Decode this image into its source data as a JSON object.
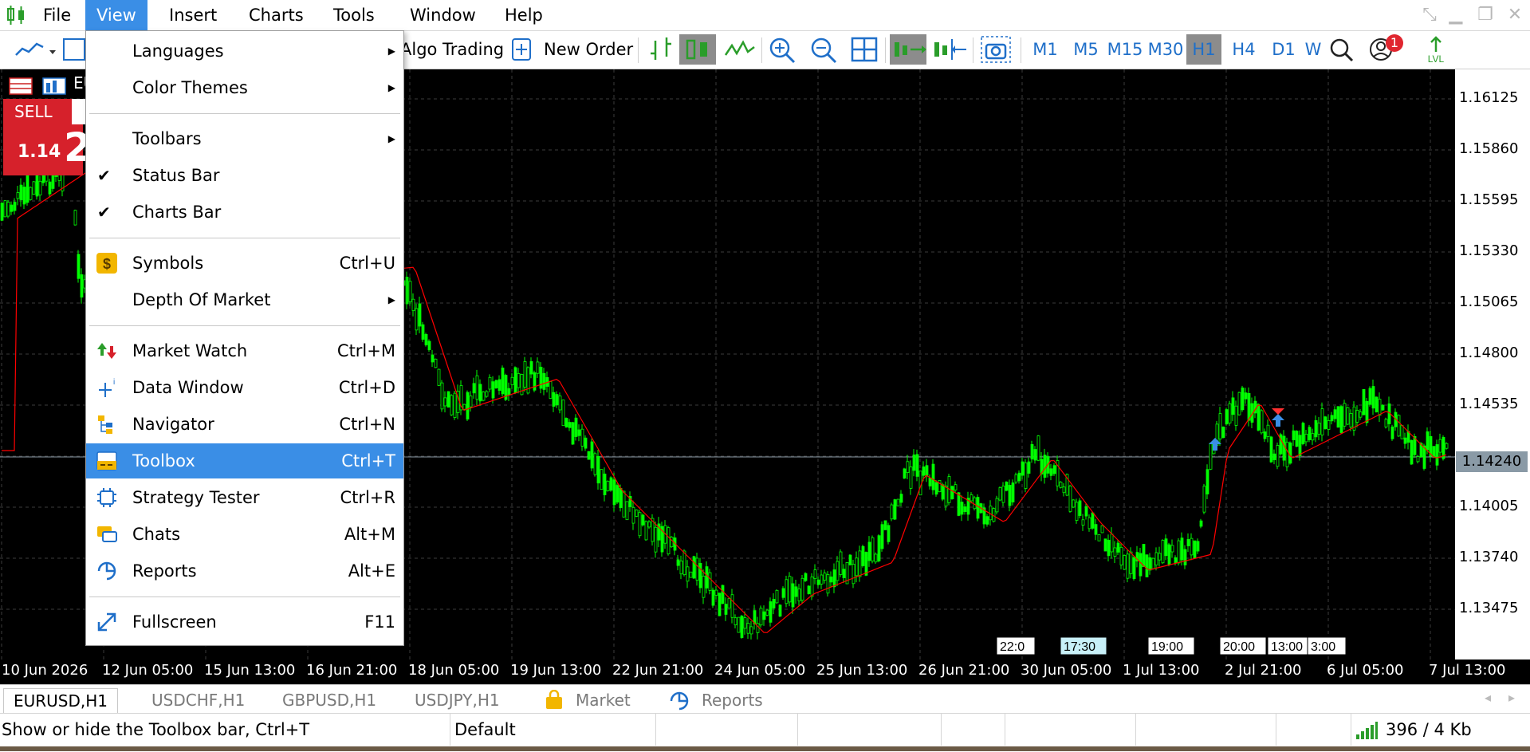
{
  "menubar": {
    "items": [
      "File",
      "View",
      "Insert",
      "Charts",
      "Tools",
      "Window",
      "Help"
    ],
    "open_item": "View"
  },
  "toolbar": {
    "algo_trading": "Algo Trading",
    "new_order": "New Order",
    "timeframes": [
      "M1",
      "M5",
      "M15",
      "M30",
      "H1",
      "H4",
      "D1",
      "W"
    ],
    "active_timeframe": "H1",
    "notification_count": "1",
    "lvl_label": "LVL"
  },
  "view_menu": {
    "items": [
      {
        "label": "Languages",
        "shortcut": "",
        "submenu": true
      },
      {
        "label": "Color Themes",
        "shortcut": "",
        "submenu": true
      },
      {
        "label": "Toolbars",
        "shortcut": "",
        "submenu": true
      },
      {
        "label": "Status Bar",
        "shortcut": "",
        "checked": true
      },
      {
        "label": "Charts Bar",
        "shortcut": "",
        "checked": true
      },
      {
        "label": "Symbols",
        "shortcut": "Ctrl+U",
        "icon": "dollar-icon"
      },
      {
        "label": "Depth Of Market",
        "shortcut": "",
        "submenu": true
      },
      {
        "label": "Market Watch",
        "shortcut": "Ctrl+M",
        "icon": "market-watch-icon"
      },
      {
        "label": "Data Window",
        "shortcut": "Ctrl+D",
        "icon": "data-window-icon"
      },
      {
        "label": "Navigator",
        "shortcut": "Ctrl+N",
        "icon": "navigator-icon"
      },
      {
        "label": "Toolbox",
        "shortcut": "Ctrl+T",
        "icon": "toolbox-icon",
        "highlighted": true
      },
      {
        "label": "Strategy Tester",
        "shortcut": "Ctrl+R",
        "icon": "strategy-tester-icon"
      },
      {
        "label": "Chats",
        "shortcut": "Alt+M",
        "icon": "chats-icon"
      },
      {
        "label": "Reports",
        "shortcut": "Alt+E",
        "icon": "reports-icon"
      },
      {
        "label": "Fullscreen",
        "shortcut": "F11",
        "icon": "fullscreen-icon"
      }
    ]
  },
  "chart": {
    "symbol_short": "EU",
    "sell_label": "SELL",
    "sell_price_small": "1.14",
    "sell_price_big": "2",
    "prices": [
      "1.16125",
      "1.15860",
      "1.15595",
      "1.15330",
      "1.15065",
      "1.14800",
      "1.14535",
      "1.14240",
      "1.14005",
      "1.13740",
      "1.13475"
    ],
    "current_price": "1.14240",
    "times": [
      "10 Jun 2026",
      "12 Jun 05:00",
      "15 Jun 13:00",
      "16 Jun 21:00",
      "18 Jun 05:00",
      "19 Jun 13:00",
      "22 Jun 21:00",
      "24 Jun 05:00",
      "25 Jun 13:00",
      "26 Jun 21:00",
      "30 Jun 05:00",
      "1 Jul 13:00",
      "2 Jul 21:00",
      "6 Jul 05:00",
      "7 Jul 13:00"
    ],
    "event_labels": [
      "22:0",
      "17:30",
      "19:00",
      "20:00",
      "13:00",
      "3:00"
    ]
  },
  "tabs": {
    "items": [
      "EURUSD,H1",
      "USDCHF,H1",
      "GBPUSD,H1",
      "USDJPY,H1",
      "Market",
      "Reports"
    ],
    "active": "EURUSD,H1"
  },
  "statusbar": {
    "hint": "Show or hide the Toolbox bar, Ctrl+T",
    "profile": "Default",
    "traffic": "396 / 4 Kb"
  },
  "colors": {
    "menu_highlight": "#3a8ee6",
    "candle": "#00ff00",
    "ma_line": "#ff0000",
    "sell_red": "#d6212b",
    "timeframe_blue": "#1f6fc9"
  }
}
